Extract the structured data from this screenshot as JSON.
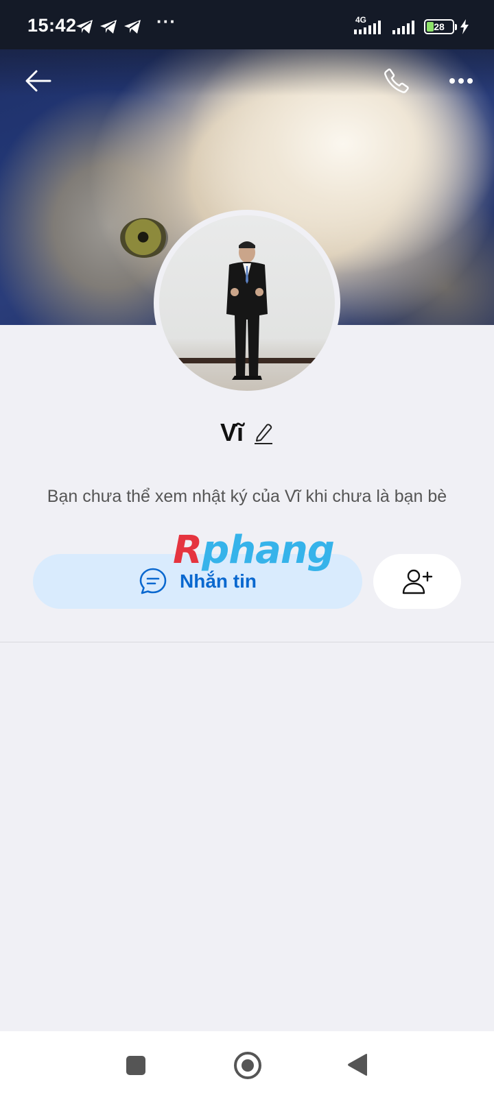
{
  "status_bar": {
    "time": "15:42",
    "more": "···",
    "network": "4G",
    "battery_level": "28",
    "battery_fraction": 0.28
  },
  "header": {
    "back_icon": "arrow-left-icon",
    "call_icon": "phone-icon",
    "more_icon": "more-horizontal-icon"
  },
  "profile": {
    "name": "Vĩ",
    "edit_icon": "pencil-icon",
    "notice": "Bạn chưa thể xem nhật ký của Vĩ khi chưa là bạn bè"
  },
  "actions": {
    "message_label": "Nhắn tin",
    "message_icon": "chat-bubble-icon",
    "add_friend_icon": "add-friend-icon"
  },
  "watermark": {
    "part1": "R",
    "part2": "phang"
  },
  "colors": {
    "accent": "#0a68cf",
    "accent_bg": "#d9ebfd",
    "page_bg": "#f0f0f5"
  }
}
